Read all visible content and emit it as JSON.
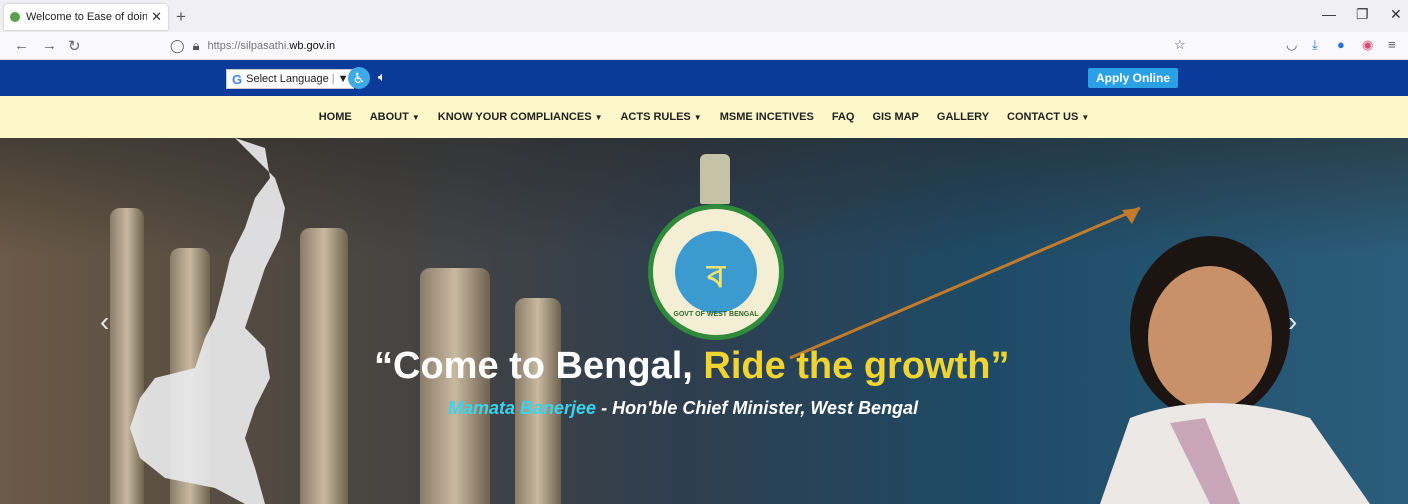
{
  "browser": {
    "tab_title": "Welcome to Ease of doing busin",
    "url_prefix": "https://silpasathi.",
    "url_host": "wb.gov.in"
  },
  "topbar": {
    "translate_label": "Select Language",
    "translate_caret": "▼",
    "apply_label": "Apply Online"
  },
  "nav": {
    "items": [
      {
        "label": "HOME",
        "dropdown": false
      },
      {
        "label": "ABOUT",
        "dropdown": true
      },
      {
        "label": "KNOW YOUR COMPLIANCES",
        "dropdown": true
      },
      {
        "label": "ACTS RULES",
        "dropdown": true
      },
      {
        "label": "MSME INCETIVES",
        "dropdown": false
      },
      {
        "label": "FAQ",
        "dropdown": false
      },
      {
        "label": "GIS MAP",
        "dropdown": false
      },
      {
        "label": "GALLERY",
        "dropdown": false
      },
      {
        "label": "CONTACT US",
        "dropdown": true
      }
    ]
  },
  "hero": {
    "headline_open": "“",
    "headline_main": "Come to Bengal, ",
    "headline_accent": "Ride the growth",
    "headline_close": "”",
    "sub_name": "Mamata Banerjee",
    "sub_rest": " - Hon'ble Chief Minister, West Bengal",
    "seal_text": "GOVT OF WEST BENGAL"
  },
  "colors": {
    "topbar": "#0a3a9a",
    "nav_bg": "#fdf8c9",
    "apply": "#2aa0e6",
    "headline_accent": "#f0d431",
    "sub_name": "#38d4f0"
  }
}
